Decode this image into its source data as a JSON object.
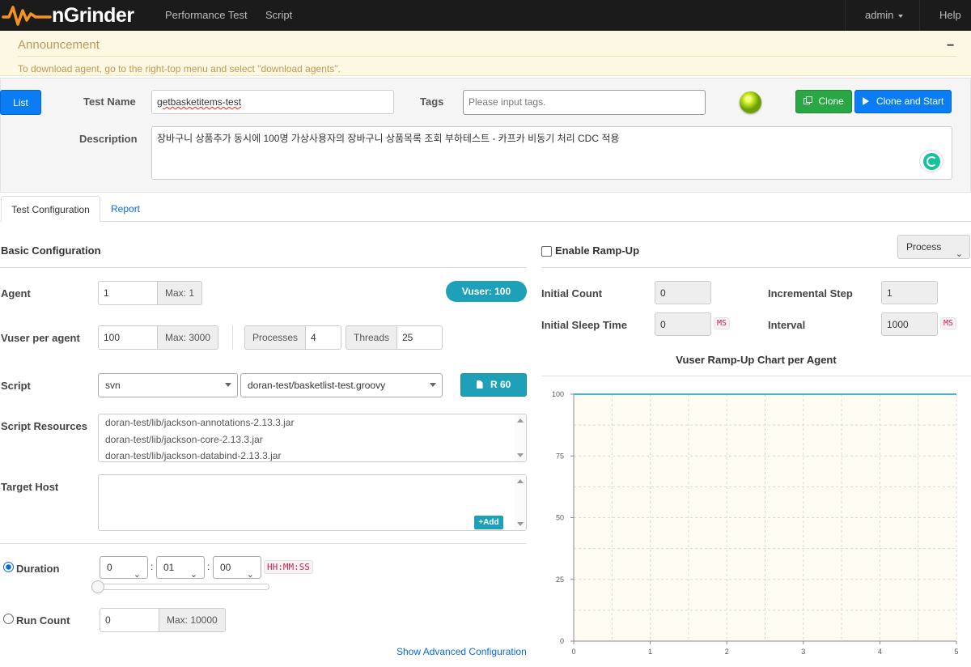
{
  "nav": {
    "brand": "nGrinder",
    "items": [
      "Performance Test",
      "Script"
    ],
    "user": "admin",
    "help": "Help"
  },
  "announcement": {
    "title": "Announcement",
    "collapse": "−",
    "text": "To download agent, go to the right-top menu and select \"download agents\"."
  },
  "header": {
    "list_label": "List",
    "test_name_label": "Test Name",
    "test_name_value": "getbasketitems-test",
    "tags_label": "Tags",
    "tags_placeholder": "Please input tags.",
    "clone_label": "Clone",
    "clone_start_label": "Clone and Start",
    "description_label": "Description",
    "description_value": "장바구니 상품추가 동시에 100명 가상사용자의 장바구니 상품목록 조회 부하테스트 - 카프카 비동기 처리 CDC 적용"
  },
  "tabs": {
    "config": "Test Configuration",
    "report": "Report"
  },
  "basic": {
    "title": "Basic Configuration",
    "agent_label": "Agent",
    "agent_value": "1",
    "agent_max": "Max: 1",
    "vuser_badge": "Vuser: 100",
    "vuser_per_agent_label": "Vuser per agent",
    "vuser_per_agent_value": "100",
    "vuser_max": "Max: 3000",
    "processes_label": "Processes",
    "processes_value": "4",
    "threads_label": "Threads",
    "threads_value": "25",
    "script_label": "Script",
    "script_repo": "svn",
    "script_file": "doran-test/basketlist-test.groovy",
    "script_button": "R 60",
    "resources_label": "Script Resources",
    "resources": [
      "doran-test/lib/jackson-annotations-2.13.3.jar",
      "doran-test/lib/jackson-core-2.13.3.jar",
      "doran-test/lib/jackson-databind-2.13.3.jar"
    ],
    "target_host_label": "Target Host",
    "add_label": "Add",
    "duration_label": "Duration",
    "duration_hours": "0",
    "duration_minutes": "01",
    "duration_seconds": "00",
    "duration_sep": ":",
    "duration_format": "HH:MM:SS",
    "run_count_label": "Run Count",
    "run_count_value": "0",
    "run_count_max": "Max: 10000",
    "advanced_link": "Show Advanced Configuration"
  },
  "rampup": {
    "enable_label": "Enable Ramp-Up",
    "mode": "Process",
    "initial_count_label": "Initial Count",
    "initial_count_value": "0",
    "incremental_step_label": "Incremental Step",
    "incremental_step_value": "1",
    "initial_sleep_label": "Initial Sleep Time",
    "initial_sleep_value": "0",
    "interval_label": "Interval",
    "interval_value": "1000",
    "ms_unit": "MS"
  },
  "chart_data": {
    "type": "line",
    "title": "Vuser Ramp-Up Chart per Agent",
    "x": [
      0,
      5
    ],
    "series": [
      {
        "values": [
          100,
          100
        ]
      }
    ],
    "xlim": [
      0,
      5
    ],
    "ylim": [
      0,
      100
    ],
    "x_ticks": [
      "0",
      "1",
      "2",
      "3",
      "4",
      "5"
    ],
    "y_ticks": [
      "0",
      "25",
      "50",
      "75",
      "100"
    ],
    "grid": true,
    "line_color": "#4bb1c6",
    "background": "#fffdf3"
  }
}
